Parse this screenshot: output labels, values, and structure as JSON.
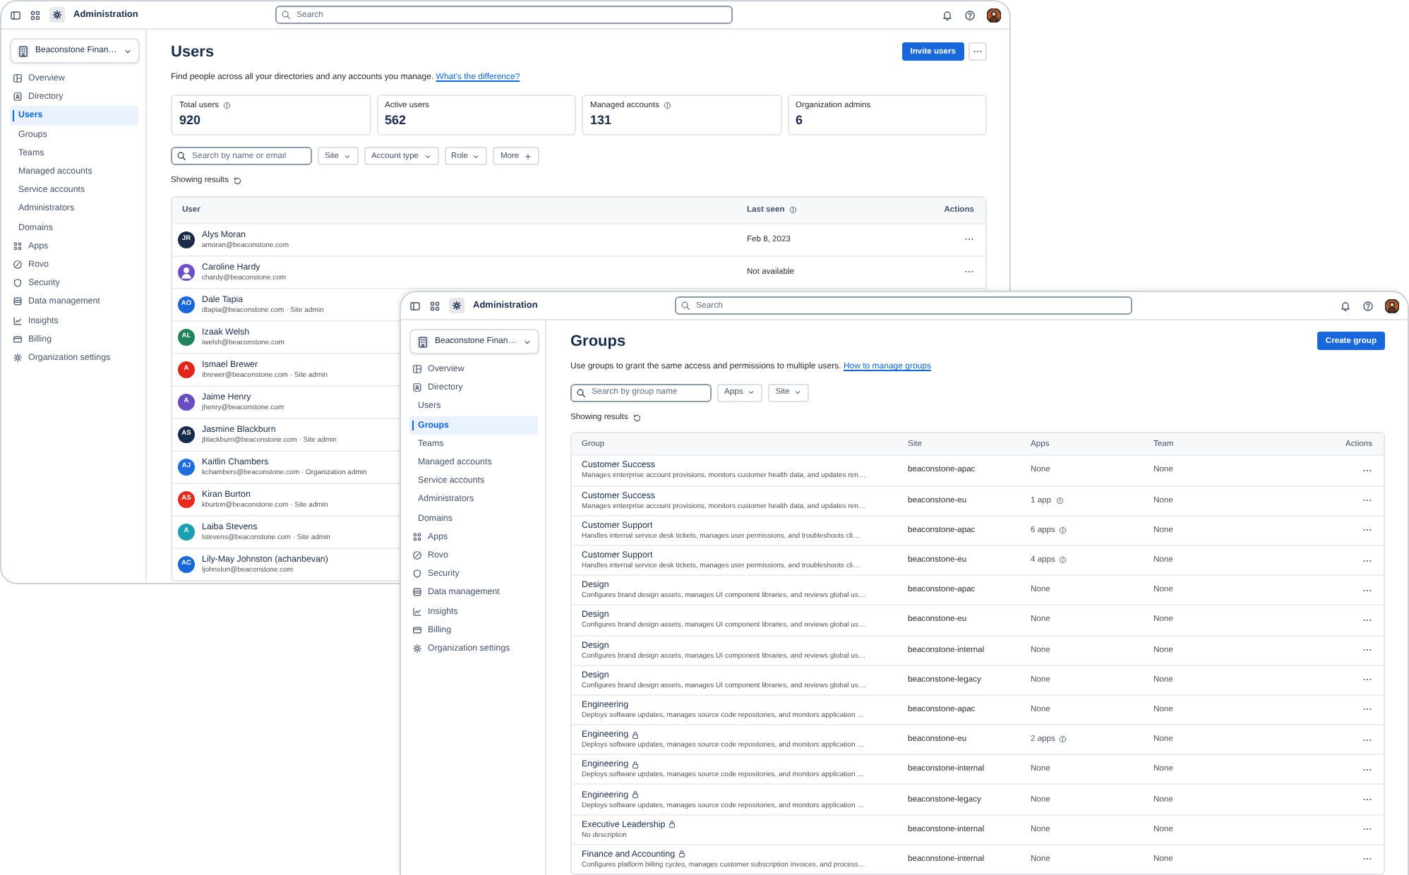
{
  "windows": [
    {
      "kind": "users",
      "app_title": "Administration",
      "search_placeholder": "Search",
      "org": "Beaconstone Finan…",
      "sidebar": [
        {
          "label": "Overview",
          "selected": false
        },
        {
          "label": "Directory",
          "selected": false,
          "children": [
            {
              "label": "Users",
              "selected": true
            },
            {
              "label": "Groups",
              "selected": false
            },
            {
              "label": "Teams",
              "selected": false
            },
            {
              "label": "Managed accounts",
              "selected": false
            },
            {
              "label": "Service accounts",
              "selected": false
            },
            {
              "label": "Administrators",
              "selected": false
            },
            {
              "label": "Domains",
              "selected": false
            }
          ]
        },
        {
          "label": "Apps",
          "selected": false
        },
        {
          "label": "Rovo",
          "selected": false
        },
        {
          "label": "Security",
          "selected": false
        },
        {
          "label": "Data management",
          "selected": false
        },
        {
          "label": "Insights",
          "selected": false
        },
        {
          "label": "Billing",
          "selected": false
        },
        {
          "label": "Organization settings",
          "selected": false
        }
      ],
      "page": {
        "title": "Users",
        "primary_button": "Invite users",
        "description": "Find people across all your directories and any accounts you manage.",
        "link": "What's the difference?",
        "stats": [
          {
            "label": "Total users",
            "value": "920",
            "info": true
          },
          {
            "label": "Active users",
            "value": "562",
            "info": false
          },
          {
            "label": "Managed accounts",
            "value": "131",
            "info": true
          },
          {
            "label": "Organization admins",
            "value": "6",
            "info": false
          }
        ],
        "search_placeholder": "Search by name or email",
        "filters": [
          {
            "label": "Site",
            "kind": "dropdown"
          },
          {
            "label": "Account type",
            "kind": "dropdown"
          },
          {
            "label": "Role",
            "kind": "dropdown"
          },
          {
            "label": "More",
            "kind": "add"
          }
        ],
        "results_label": "Showing results",
        "columns": [
          {
            "label": "User",
            "info": false
          },
          {
            "label": "Last seen",
            "info": true
          },
          {
            "label": "Actions",
            "info": false
          }
        ],
        "rows": [
          {
            "name": "Alys Moran",
            "email": "amoran@beaconstone.com",
            "initials": "JR",
            "color": "#1c2b4a",
            "last_seen": "Feb 8, 2023"
          },
          {
            "name": "Caroline Hardy",
            "email": "chardy@beaconstone.com",
            "color": "#6e4fc9",
            "last_seen": "Not available"
          },
          {
            "name": "Dale Tapia",
            "email": "dtapia@beaconstone.com · Site admin",
            "initials": "AO",
            "color": "#1868db"
          },
          {
            "name": "Izaak Welsh",
            "email": "iwelsh@beaconstone.com",
            "initials": "AL",
            "color": "#1f845a"
          },
          {
            "name": "Ismael Brewer",
            "email": "ibrewer@beaconstone.com · Site admin",
            "initials": "A",
            "color": "#e2261a"
          },
          {
            "name": "Jaime Henry",
            "email": "jhenry@beaconstone.com",
            "initials": "A",
            "color": "#6a4cc2"
          },
          {
            "name": "Jasmine Blackburn",
            "email": "jblackburn@beaconstone.com · Site admin",
            "initials": "AS",
            "color": "#172b4d"
          },
          {
            "name": "Kaitlin Chambers",
            "email": "kchambers@beaconstone.com · Organization admin",
            "initials": "AJ",
            "color": "#1d6fe0"
          },
          {
            "name": "Kiran Burton",
            "email": "kburton@beaconstone.com · Site admin",
            "initials": "AS",
            "color": "#e8291c"
          },
          {
            "name": "Laiba Stevens",
            "email": "lstevens@beaconstone.com · Site admin",
            "initials": "A",
            "color": "#1d9fb3"
          },
          {
            "name": "Lily-May Johnston (achanbevan)",
            "email": "ljohnston@beaconstone.com",
            "initials": "AC",
            "color": "#1868db"
          }
        ]
      }
    },
    {
      "kind": "groups",
      "app_title": "Administration",
      "search_placeholder": "Search",
      "org": "Beaconstone Finan…",
      "sidebar": [
        {
          "label": "Overview",
          "selected": false
        },
        {
          "label": "Directory",
          "selected": false,
          "children": [
            {
              "label": "Users",
              "selected": false
            },
            {
              "label": "Groups",
              "selected": true
            },
            {
              "label": "Teams",
              "selected": false
            },
            {
              "label": "Managed accounts",
              "selected": false
            },
            {
              "label": "Service accounts",
              "selected": false
            },
            {
              "label": "Administrators",
              "selected": false
            },
            {
              "label": "Domains",
              "selected": false
            }
          ]
        },
        {
          "label": "Apps",
          "selected": false
        },
        {
          "label": "Rovo",
          "selected": false
        },
        {
          "label": "Security",
          "selected": false
        },
        {
          "label": "Data management",
          "selected": false
        },
        {
          "label": "Insights",
          "selected": false
        },
        {
          "label": "Billing",
          "selected": false
        },
        {
          "label": "Organization settings",
          "selected": false
        }
      ],
      "page": {
        "title": "Groups",
        "primary_button": "Create group",
        "description": "Use groups to grant the same access and permissions to multiple users.",
        "link": "How to manage groups",
        "search_placeholder": "Search by group name",
        "filters": [
          {
            "label": "Apps",
            "kind": "dropdown"
          },
          {
            "label": "Site",
            "kind": "dropdown"
          }
        ],
        "results_label": "Showing results",
        "columns": [
          {
            "label": "Group",
            "info": false
          },
          {
            "label": "Site",
            "info": false
          },
          {
            "label": "Apps",
            "info": false
          },
          {
            "label": "Team",
            "info": false
          },
          {
            "label": "Actions",
            "info": false
          }
        ],
        "rows": [
          {
            "name": "Customer Success",
            "locked": false,
            "description": "Manages enterprise account provisions, monitors customer health data, and updates ren…",
            "site": "beaconstone-apac",
            "apps": "None",
            "apps_info": false,
            "team": "None"
          },
          {
            "name": "Customer Success",
            "locked": false,
            "description": "Manages enterprise account provisions, monitors customer health data, and updates ren…",
            "site": "beaconstone-eu",
            "apps": "1 app",
            "apps_info": true,
            "team": "None"
          },
          {
            "name": "Customer Support",
            "locked": false,
            "description": "Handles internal service desk tickets, manages user permissions, and troubleshoots cli…",
            "site": "beaconstone-apac",
            "apps": "6 apps",
            "apps_info": true,
            "team": "None"
          },
          {
            "name": "Customer Support",
            "locked": false,
            "description": "Handles internal service desk tickets, manages user permissions, and troubleshoots cli…",
            "site": "beaconstone-eu",
            "apps": "4 apps",
            "apps_info": true,
            "team": "None"
          },
          {
            "name": "Design",
            "locked": false,
            "description": "Configures brand design assets, manages UI component libraries, and reviews global us…",
            "site": "beaconstone-apac",
            "apps": "None",
            "apps_info": false,
            "team": "None"
          },
          {
            "name": "Design",
            "locked": false,
            "description": "Configures brand design assets, manages UI component libraries, and reviews global us…",
            "site": "beaconstone-eu",
            "apps": "None",
            "apps_info": false,
            "team": "None"
          },
          {
            "name": "Design",
            "locked": false,
            "description": "Configures brand design assets, manages UI component libraries, and reviews global us…",
            "site": "beaconstone-internal",
            "apps": "None",
            "apps_info": false,
            "team": "None"
          },
          {
            "name": "Design",
            "locked": false,
            "description": "Configures brand design assets, manages UI component libraries, and reviews global us…",
            "site": "beaconstone-legacy",
            "apps": "None",
            "apps_info": false,
            "team": "None"
          },
          {
            "name": "Engineering",
            "locked": false,
            "description": "Deploys software updates, manages source code repositories, and monitors application …",
            "site": "beaconstone-apac",
            "apps": "None",
            "apps_info": false,
            "team": "None"
          },
          {
            "name": "Engineering",
            "locked": true,
            "description": "Deploys software updates, manages source code repositories, and monitors application …",
            "site": "beaconstone-eu",
            "apps": "2 apps",
            "apps_info": true,
            "team": "None"
          },
          {
            "name": "Engineering",
            "locked": true,
            "description": "Deploys software updates, manages source code repositories, and monitors application …",
            "site": "beaconstone-internal",
            "apps": "None",
            "apps_info": false,
            "team": "None"
          },
          {
            "name": "Engineering",
            "locked": true,
            "description": "Deploys software updates, manages source code repositories, and monitors application …",
            "site": "beaconstone-legacy",
            "apps": "None",
            "apps_info": false,
            "team": "None"
          },
          {
            "name": "Executive Leadership",
            "locked": true,
            "description": "No description",
            "site": "beaconstone-internal",
            "apps": "None",
            "apps_info": false,
            "team": "None"
          },
          {
            "name": "Finance and Accounting",
            "locked": true,
            "description": "Configures platform billing cycles, manages customer subscription invoices, and process…",
            "site": "beaconstone-internal",
            "apps": "None",
            "apps_info": false,
            "team": "None"
          }
        ]
      }
    }
  ]
}
